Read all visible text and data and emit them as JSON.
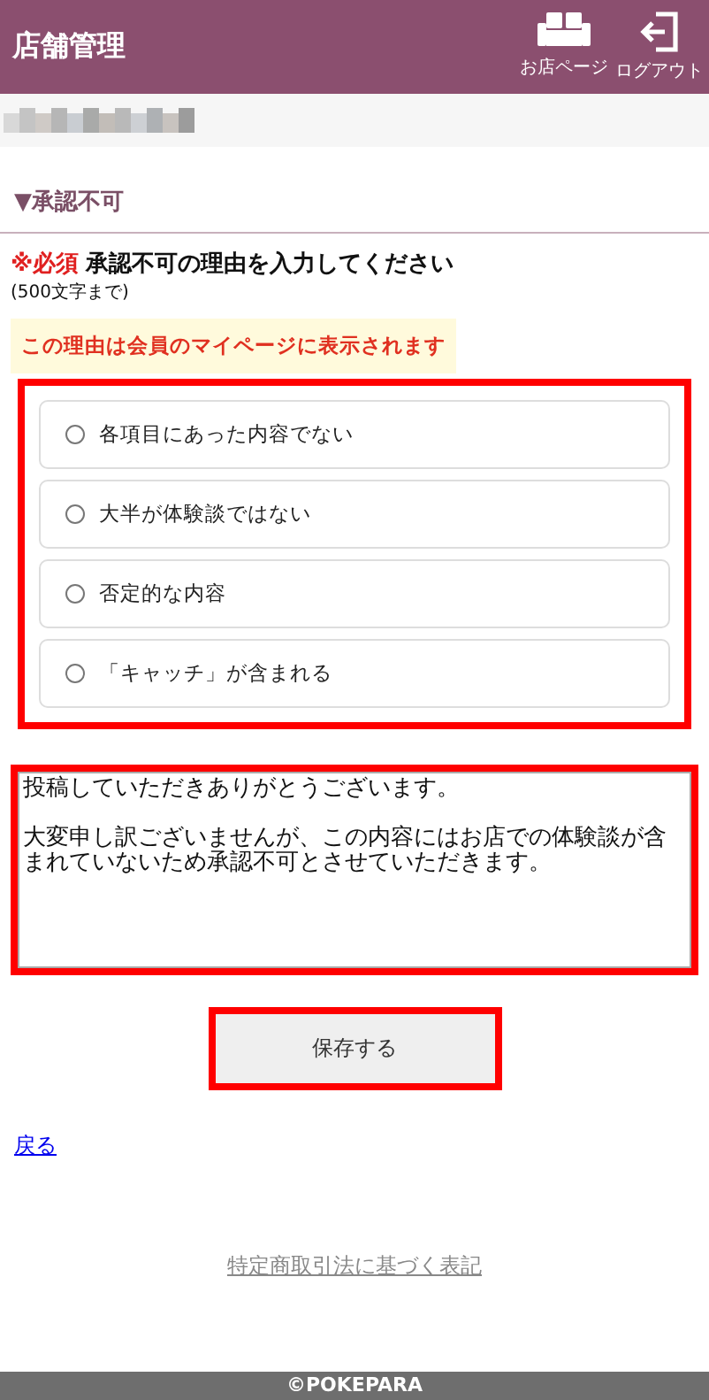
{
  "header": {
    "title": "店舗管理",
    "actions": [
      {
        "kind": "shop",
        "label": "お店ページ"
      },
      {
        "kind": "logout",
        "label": "ログアウト"
      }
    ]
  },
  "section": {
    "marker": "▼",
    "title": "承認不可"
  },
  "form": {
    "required": "※必須",
    "question": "承認不可の理由を入力してください",
    "limit": "(500文字まで)",
    "notice": "この理由は会員のマイページに表示されます",
    "reasons_highlighted": true,
    "reasons": [
      {
        "label": "各項目にあった内容でない",
        "selected": false
      },
      {
        "label": "大半が体験談ではない",
        "selected": false
      },
      {
        "label": "否定的な内容",
        "selected": false
      },
      {
        "label": "「キャッチ」が含まれる",
        "selected": false
      }
    ],
    "message_highlighted": true,
    "message": [
      "投稿していただきありがとうございます。",
      "大変申し訳ございませんが、この内容にはお店での体験談が含まれていないため承認不可とさせていただきます。"
    ],
    "save_highlighted": true,
    "save": "保存する"
  },
  "back": "戻る",
  "legal_link": "特定商取引法に基づく表記",
  "copyright": "©POKEPARA"
}
